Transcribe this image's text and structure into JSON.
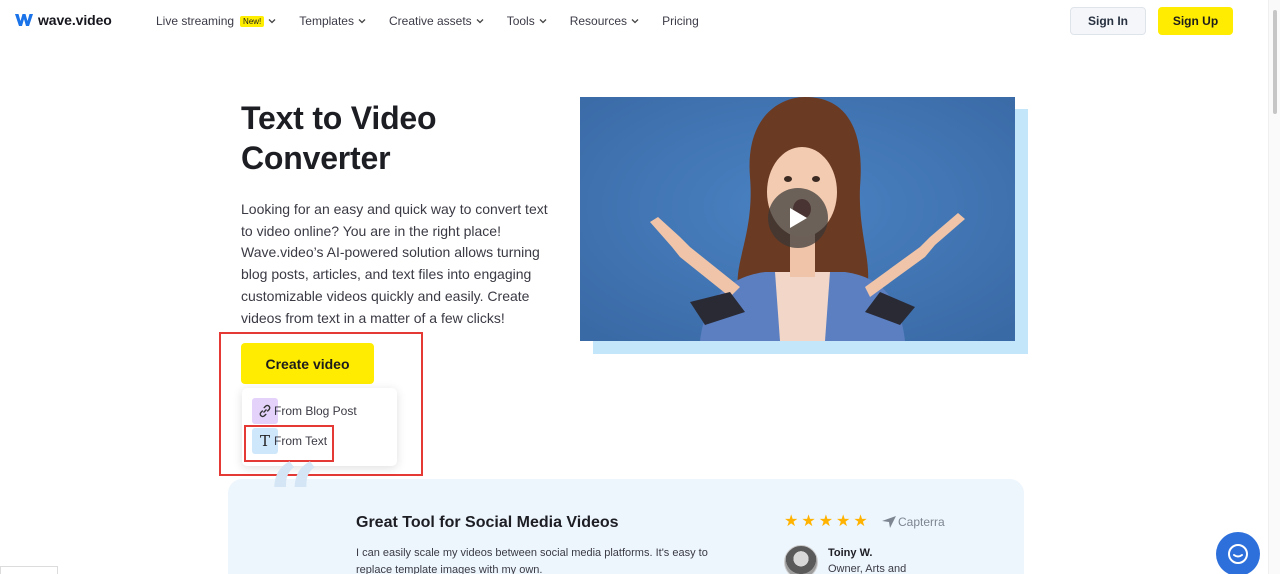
{
  "brand": {
    "name": "wave.video"
  },
  "nav": {
    "items": [
      {
        "label": "Live streaming",
        "badge": "New!",
        "has_dropdown": true
      },
      {
        "label": "Templates",
        "has_dropdown": true
      },
      {
        "label": "Creative assets",
        "has_dropdown": true
      },
      {
        "label": "Tools",
        "has_dropdown": true
      },
      {
        "label": "Resources",
        "has_dropdown": true
      },
      {
        "label": "Pricing",
        "has_dropdown": false
      }
    ],
    "sign_in": "Sign In",
    "sign_up": "Sign Up"
  },
  "hero": {
    "title": "Text to Video Converter",
    "description": "Looking for an easy and quick way to convert text to video online? You are in the right place! Wave.video’s AI-powered solution allows turning blog posts, articles, and text files into engaging customizable videos quickly and easily. Create videos from text in a matter of a few clicks!",
    "cta": "Create video",
    "dropdown": [
      {
        "label": "From Blog Post",
        "icon": "link-icon"
      },
      {
        "label": "From Text",
        "icon": "text-icon"
      }
    ]
  },
  "video": {
    "icon": "play-icon"
  },
  "testimonial": {
    "title": "Great Tool for Social Media Videos",
    "text": "I can easily scale my videos between social media platforms. It's easy to replace template images with my own.",
    "rating": 5,
    "source": "Capterra",
    "author_name": "Toiny W.",
    "author_role": "Owner, Arts and"
  },
  "colors": {
    "accent_yellow": "#ffec00",
    "highlight_red": "#e53935",
    "video_blue": "#3f74b3",
    "testimonial_bg": "#eef6fd",
    "chat_blue": "#2d6fdb"
  }
}
